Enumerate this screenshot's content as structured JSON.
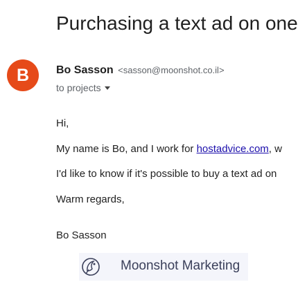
{
  "email": {
    "subject": "Purchasing a text ad on one",
    "sender": {
      "name": "Bo Sasson",
      "email": "<sasson@moonshot.co.il>",
      "avatar_letter": "B",
      "avatar_color": "#e64a19"
    },
    "to_label": "to projects",
    "body": {
      "greeting": "Hi,",
      "line2_prefix": "My name is Bo, and I work for ",
      "line2_link": "hostadvice.com",
      "line2_suffix": ", w",
      "line3": "I'd like to know if it's possible to buy a text ad on",
      "closing": "Warm regards,",
      "sign_name": "Bo Sasson"
    },
    "signature": {
      "company": "Moonshot Marketing",
      "logo_icon": "moonshot-logo-icon"
    }
  },
  "colors": {
    "link": "#1a0dab",
    "signature_bg": "#f4f5fb",
    "signature_text": "#3a3f5a"
  }
}
